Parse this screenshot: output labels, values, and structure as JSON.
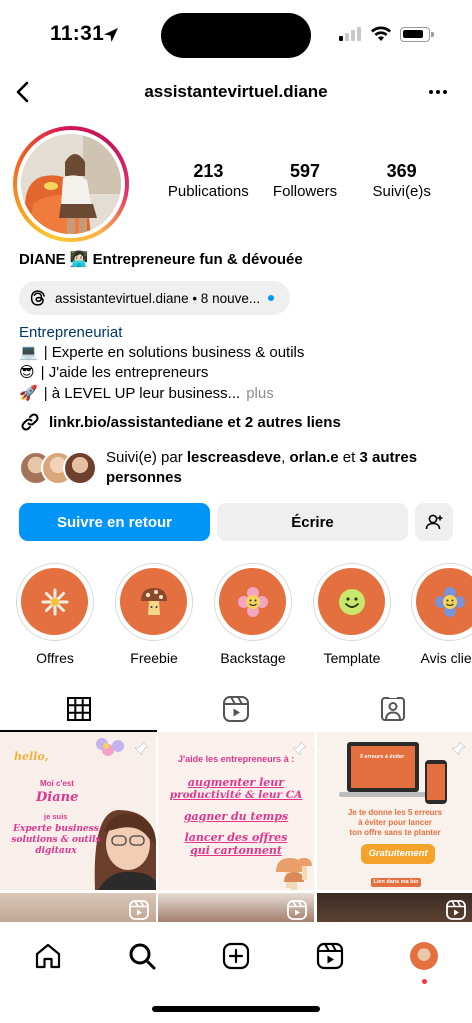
{
  "status_bar": {
    "time": "11:31"
  },
  "header": {
    "username": "assistantevirtuel.diane"
  },
  "profile": {
    "stats": [
      {
        "value": "213",
        "label": "Publications"
      },
      {
        "value": "597",
        "label": "Followers"
      },
      {
        "value": "369",
        "label": "Suivi(e)s"
      }
    ],
    "name_line": "DIANE 👩🏻‍💻 Entrepreneure fun & dévouée",
    "threads_pill": "assistantevirtuel.diane • 8 nouve...",
    "category": "Entrepreneuriat",
    "bio_lines": [
      {
        "emoji": "💻",
        "text": "| Experte en solutions business & outils"
      },
      {
        "emoji": "😎",
        "text": "| J'aide les entrepreneurs"
      },
      {
        "emoji": "🚀",
        "text": "| à LEVEL UP leur business...",
        "more": "plus"
      }
    ],
    "link": "linkr.bio/assistantediane et 2 autres liens",
    "followed_by": {
      "prefix": "Suivi(e) par ",
      "user1": "lescreasdeve",
      "sep": ", ",
      "user2": "orlan.e",
      "mid": " et ",
      "others": "3 autres personnes"
    }
  },
  "buttons": {
    "follow_back": "Suivre en retour",
    "message": "Écrire"
  },
  "highlights": [
    {
      "label": "Offres",
      "icon": "daisy-icon"
    },
    {
      "label": "Freebie",
      "icon": "mushroom-icon"
    },
    {
      "label": "Backstage",
      "icon": "smiley-flower-icon"
    },
    {
      "label": "Template",
      "icon": "smiley-face-icon"
    },
    {
      "label": "Avis clien",
      "icon": "blue-flower-icon"
    }
  ],
  "posts": [
    {
      "hello": "hello,",
      "l1": "Moi c'est",
      "l2": "Diane",
      "l3": "je suis",
      "l4": "Experte business",
      "l5": "solutions & outils",
      "l6": "digitaux"
    },
    {
      "l1": "J'aide les entrepreneurs à :",
      "l2": "augmenter leur",
      "l3": "productivité & leur CA",
      "l4": "gagner du temps",
      "l5": "lancer des offres",
      "l6": "qui cartonnent"
    },
    {
      "screen1": "5 erreurs à éviter",
      "l1": "Je te donne les 5 erreurs",
      "l2": "à éviter pour lancer",
      "l3": "ton offre sans te planter",
      "cta": "Gratuitement",
      "foot": "Lien dans ma bio"
    }
  ],
  "colors": {
    "accent_blue": "#0095f6",
    "highlight_orange": "#e4703f",
    "post_pink": "#e0368c",
    "link_blue": "#00376b"
  }
}
